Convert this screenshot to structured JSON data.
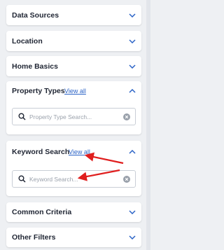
{
  "filters": {
    "data_sources": {
      "title": "Data Sources"
    },
    "location": {
      "title": "Location"
    },
    "home_basics": {
      "title": "Home Basics"
    },
    "property_types": {
      "title": "Property Types",
      "view_all": "View all",
      "placeholder": "Property Type Search..."
    },
    "keyword_search": {
      "title": "Keyword Search",
      "view_all": "View all",
      "placeholder": "Keyword Search..."
    },
    "common_criteria": {
      "title": "Common Criteria"
    },
    "other_filters": {
      "title": "Other Filters"
    }
  },
  "colors": {
    "accent": "#2b63c6",
    "annotation_arrow": "#e01e1e",
    "background": "#eef0f3"
  },
  "icons": {
    "collapsed": "chevron-down-icon",
    "expanded": "chevron-up-icon",
    "search": "search-icon",
    "clear": "clear-icon"
  }
}
